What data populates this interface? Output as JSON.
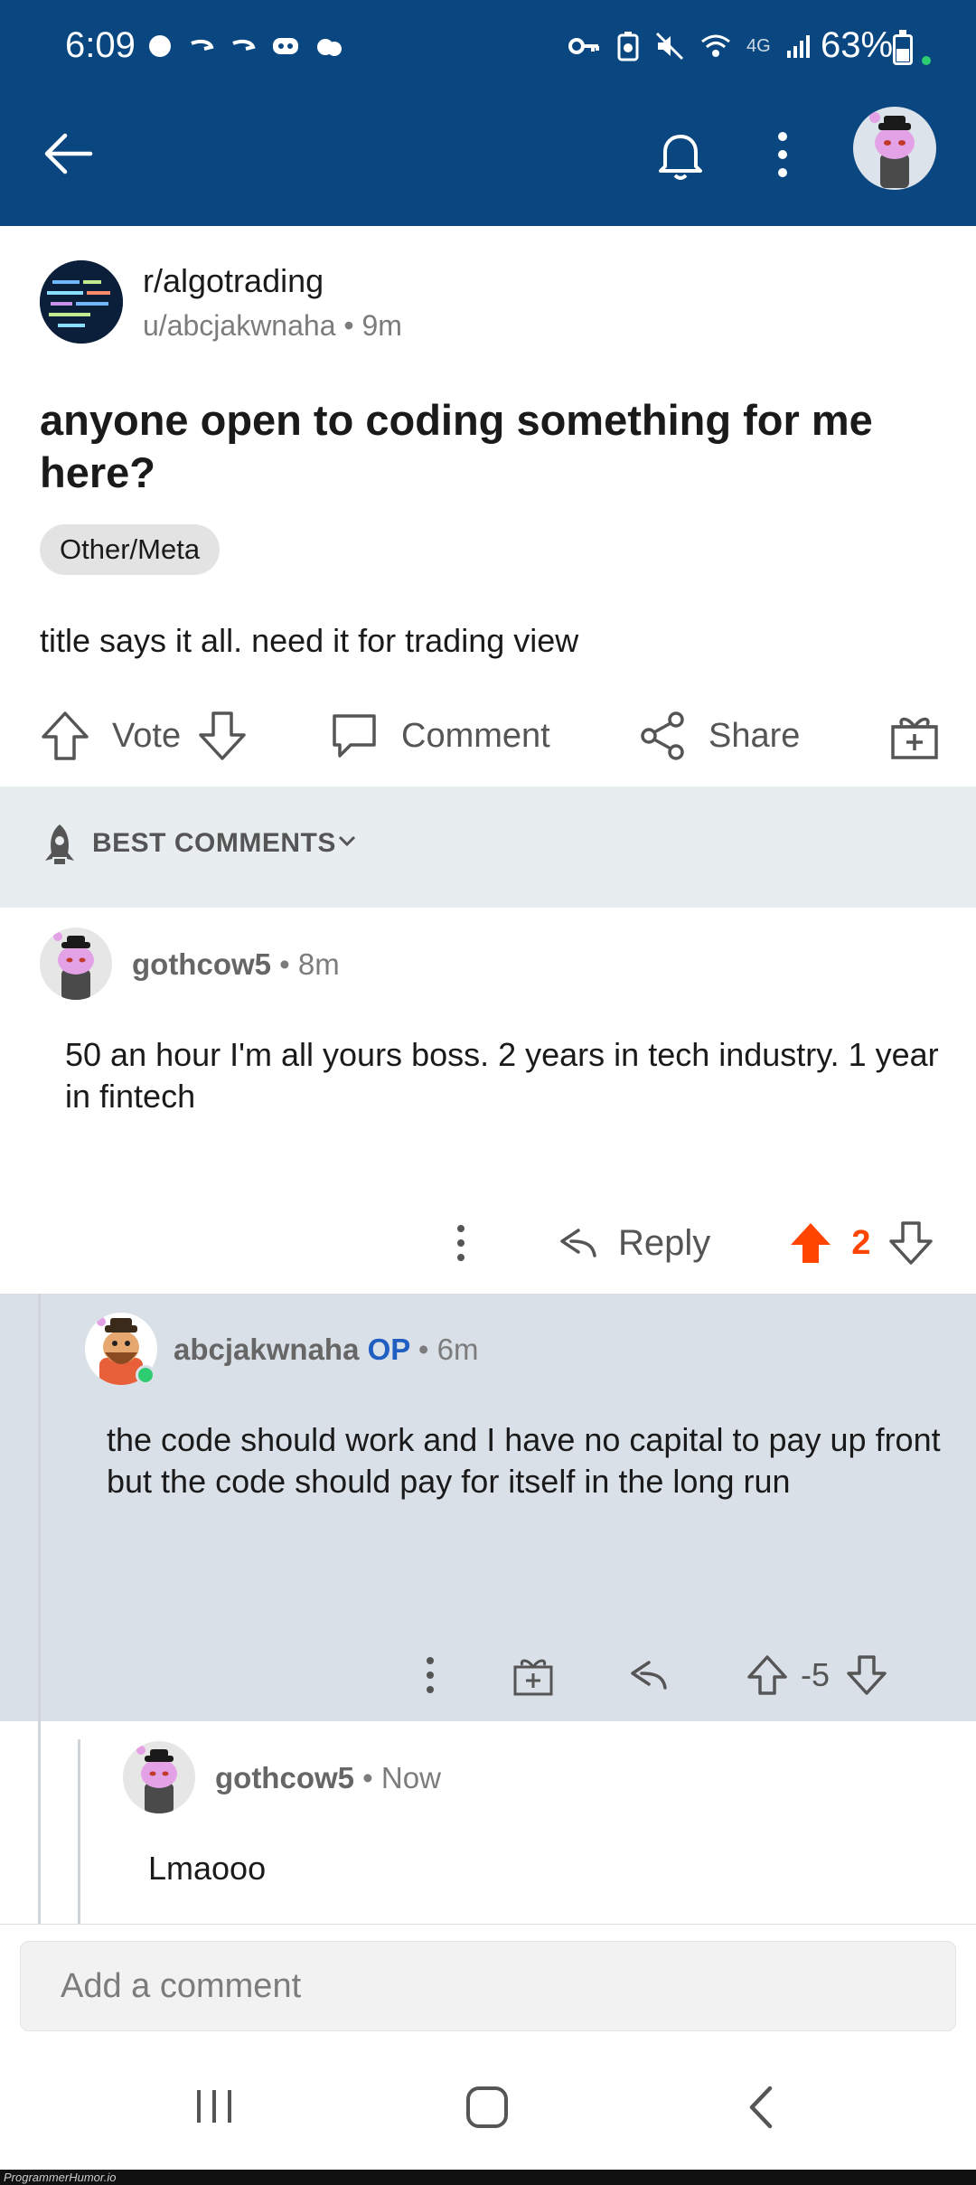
{
  "status_bar": {
    "time": "6:09",
    "network": "4G",
    "battery": "63%",
    "left_icons": [
      "chat-bubble-icon",
      "arrow-icon",
      "arrow-icon",
      "discord-icon",
      "cloud-icon"
    ],
    "right_icons": [
      "key-icon",
      "battery-saver-icon",
      "mute-icon",
      "wifi-icon",
      "signal-icon"
    ]
  },
  "app_bar": {
    "icons": [
      "back-arrow-icon",
      "bell-icon",
      "more-vertical-icon",
      "user-avatar"
    ]
  },
  "post": {
    "subreddit": "r/algotrading",
    "author": "u/abcjakwnaha",
    "time": "9m",
    "title": "anyone open to coding something for me here?",
    "flair": "Other/Meta",
    "body": "title says it all. need it for trading view",
    "actions": {
      "vote": "Vote",
      "comment": "Comment",
      "share": "Share"
    }
  },
  "sort": {
    "label": "BEST COMMENTS"
  },
  "comments": [
    {
      "author": "gothcow5",
      "op_badge": "",
      "time": "8m",
      "text": "50 an hour I'm all yours boss. 2 years in tech industry. 1 year in fintech",
      "reply_label": "Reply",
      "score": "2"
    },
    {
      "author": "abcjakwnaha",
      "op_badge": "OP",
      "time": "6m",
      "text": "the code should work and I have no capital to pay up front but the code should pay for itself in the long run",
      "score": "-5"
    },
    {
      "author": "gothcow5",
      "op_badge": "",
      "time": "Now",
      "text": "Lmaooo"
    }
  ],
  "composer": {
    "placeholder": "Add a comment"
  },
  "watermark": "ProgrammerHumor.io",
  "colors": {
    "header_bg": "#0a4780",
    "upvote_active": "#ff4500",
    "op_badge": "#1f5fc1",
    "nested_bg": "#dae0e8"
  }
}
